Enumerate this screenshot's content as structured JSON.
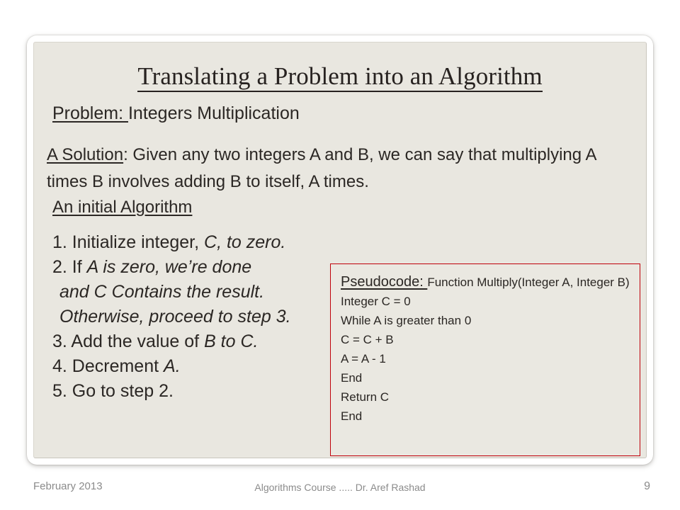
{
  "slide": {
    "title": "Translating a Problem into an Algorithm",
    "problem": {
      "label": "Problem: ",
      "text": "Integers  Multiplication"
    },
    "solution": {
      "label": "A Solution",
      "text": ":  Given any two integers A and B, we can say that multiplying A times B involves adding B to itself, A times."
    },
    "initial_algorithm_heading": "An initial Algorithm",
    "steps": [
      {
        "number": "1. ",
        "plain": "Initialize integer, ",
        "italic": "C, to zero."
      },
      {
        "number": "2. ",
        "plain": "If ",
        "italic": "A is zero, we’re done"
      },
      {
        "number": "",
        "plain": "",
        "italic": "and C Contains the result."
      },
      {
        "number": "",
        "plain": "",
        "italic": "Otherwise, proceed to step 3."
      },
      {
        "number": "3. ",
        "plain": "Add the value of ",
        "italic": "B to C."
      },
      {
        "number": "4. ",
        "plain": "Decrement ",
        "italic": "A."
      },
      {
        "number": "5. ",
        "plain": "Go to step 2.",
        "italic": ""
      }
    ],
    "pseudocode": {
      "label": "Pseudocode: ",
      "signature": "Function Multiply(Integer A, Integer B)",
      "lines": [
        "Integer C = 0",
        "While A is greater than 0",
        "C = C + B",
        "A = A - 1",
        "End",
        "Return C",
        "End"
      ]
    },
    "footer": {
      "date": "February 2013",
      "center": "Algorithms Course .....  Dr. Aref Rashad",
      "page": "9"
    },
    "colors": {
      "slide_background": "#e9e7e0",
      "text": "#2b2724",
      "pseudocode_border": "#c0000a",
      "footer_text": "#8b8b8b"
    }
  }
}
